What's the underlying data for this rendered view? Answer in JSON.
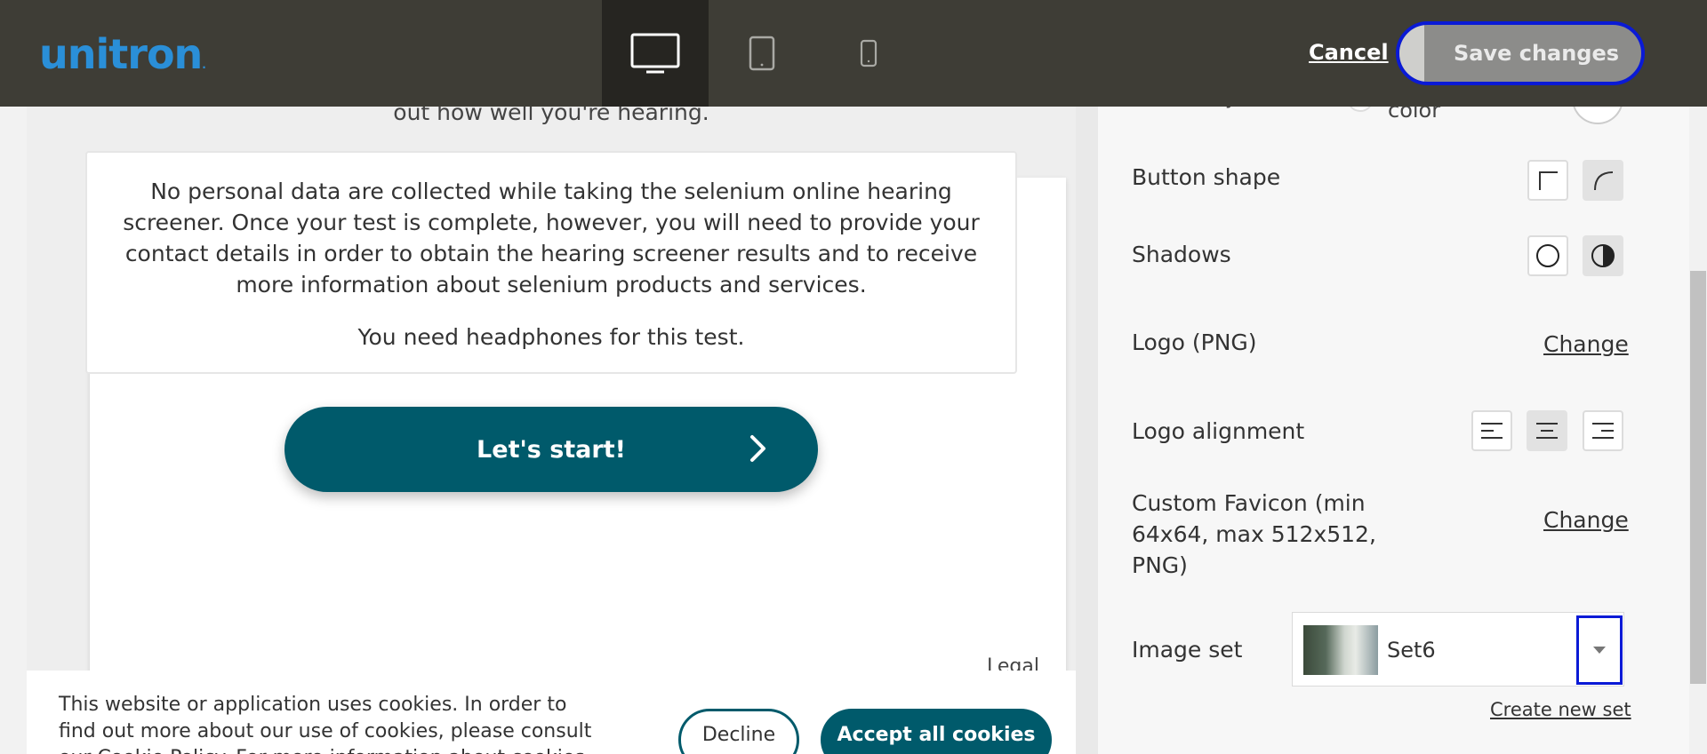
{
  "header": {
    "logo_text": "unitron",
    "logo_dot": ".",
    "cancel_label": "Cancel",
    "save_label": "Save changes",
    "devices": [
      "desktop",
      "tablet",
      "mobile"
    ],
    "active_device": "desktop"
  },
  "preview": {
    "intro_tail": "out how well you're hearing.",
    "privacy_text": "No personal data are collected while taking the selenium online hearing screener. Once your test is complete, however, you will need to provide your contact details in order to obtain the hearing screener results and to receive more information about selenium products and services.",
    "headphones_text": "You need headphones for this test.",
    "start_label": "Let's start!",
    "legal_label": "Legal"
  },
  "cookie": {
    "text": "This website or application uses cookies. In order to find out more about our use of cookies, please consult our Cookie Policy. For more information about cookies",
    "decline_label": "Decline",
    "accept_label": "Accept all cookies"
  },
  "settings": {
    "partial_label": "y",
    "partial_option": "color",
    "button_shape_label": "Button shape",
    "shadows_label": "Shadows",
    "logo_label": "Logo (PNG)",
    "logo_change": "Change",
    "logo_alignment_label": "Logo alignment",
    "favicon_label": "Custom Favicon (min 64x64, max 512x512, PNG)",
    "favicon_change": "Change",
    "image_set_label": "Image set",
    "image_set_value": "Set6",
    "create_new_set": "Create new set"
  },
  "colors": {
    "topbar": "#3e3d36",
    "accent": "#005a6b",
    "logo": "#2a8fd8",
    "focus": "#0a1ad6"
  }
}
